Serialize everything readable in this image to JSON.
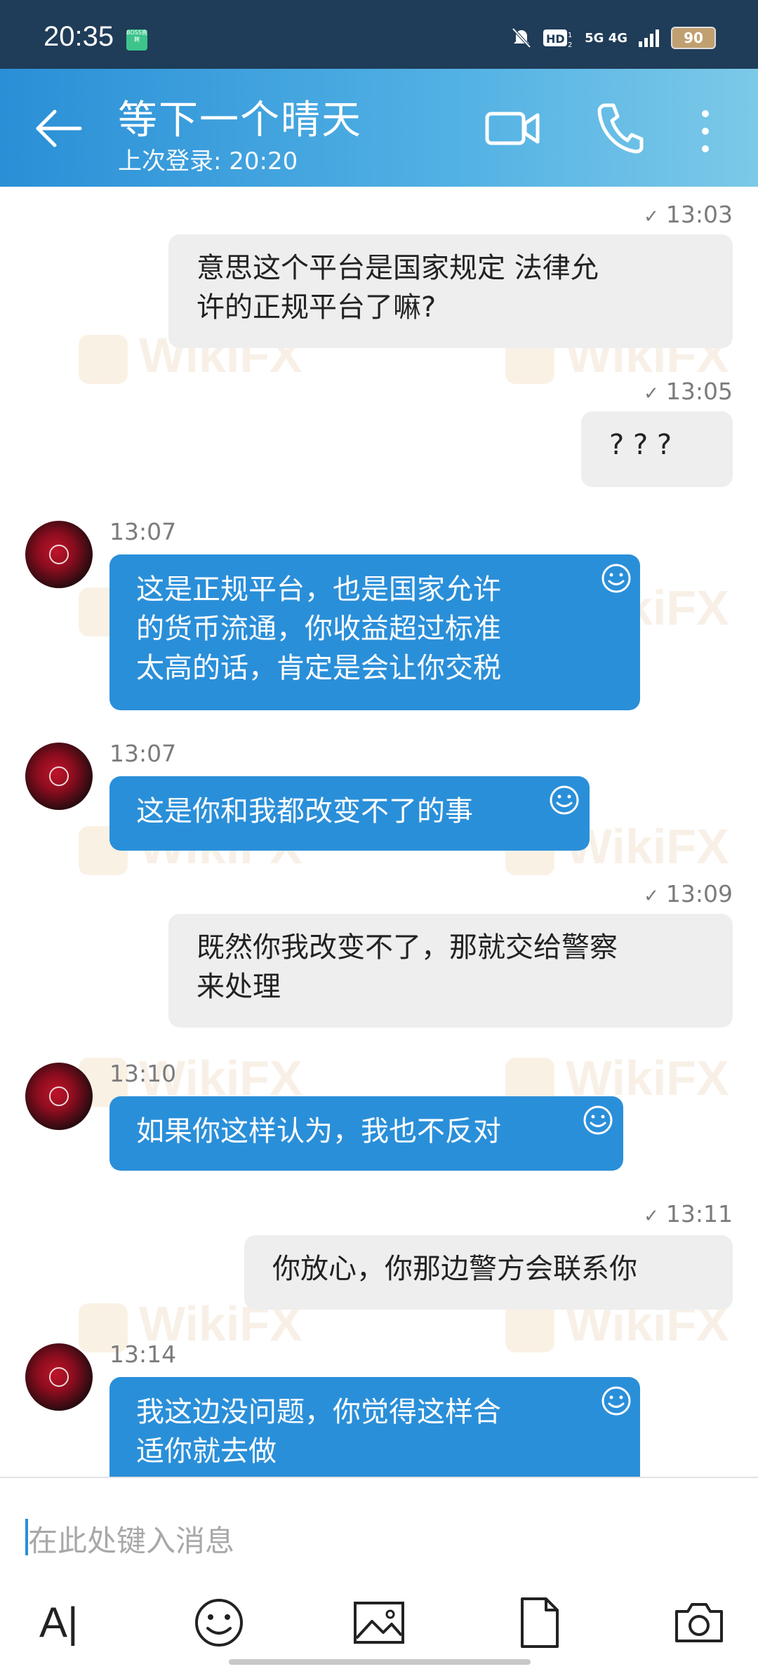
{
  "status_bar": {
    "time": "20:35",
    "boss_badge": "BOSS直聘",
    "network": "5G 4G",
    "battery": "90"
  },
  "header": {
    "title": "等下一个晴天",
    "last_login": "上次登录: 20:20"
  },
  "messages": [
    {
      "time": "13:03",
      "text_lines": [
        "意思这个平台是国家规定 法律允",
        "许的正规平台了嘛?"
      ]
    },
    {
      "time": "13:05",
      "text_lines": [
        "? ? ?"
      ]
    },
    {
      "time": "13:07",
      "text_lines": [
        "这是正规平台，也是国家允许",
        "的货币流通，你收益超过标准",
        "太高的话，肯定是会让你交税"
      ]
    },
    {
      "time": "13:07",
      "text_lines": [
        "这是你和我都改变不了的事"
      ]
    },
    {
      "time": "13:09",
      "text_lines": [
        "既然你我改变不了，那就交给警察",
        "来处理"
      ]
    },
    {
      "time": "13:10",
      "text_lines": [
        "如果你这样认为，我也不反对"
      ]
    },
    {
      "time": "13:11",
      "text_lines": [
        "你放心，你那边警方会联系你"
      ]
    },
    {
      "time": "13:14",
      "text_lines": [
        "我这边没问题，你觉得这样合",
        "适你就去做"
      ]
    }
  ],
  "input": {
    "placeholder": "在此处键入消息"
  },
  "toolbar": {
    "text_tool": "A|"
  },
  "watermark": "WikiFX",
  "colors": {
    "header_start": "#2a8fd6",
    "incoming_bubble": "#2a8fd9",
    "outgoing_bubble": "#eeeeef"
  }
}
